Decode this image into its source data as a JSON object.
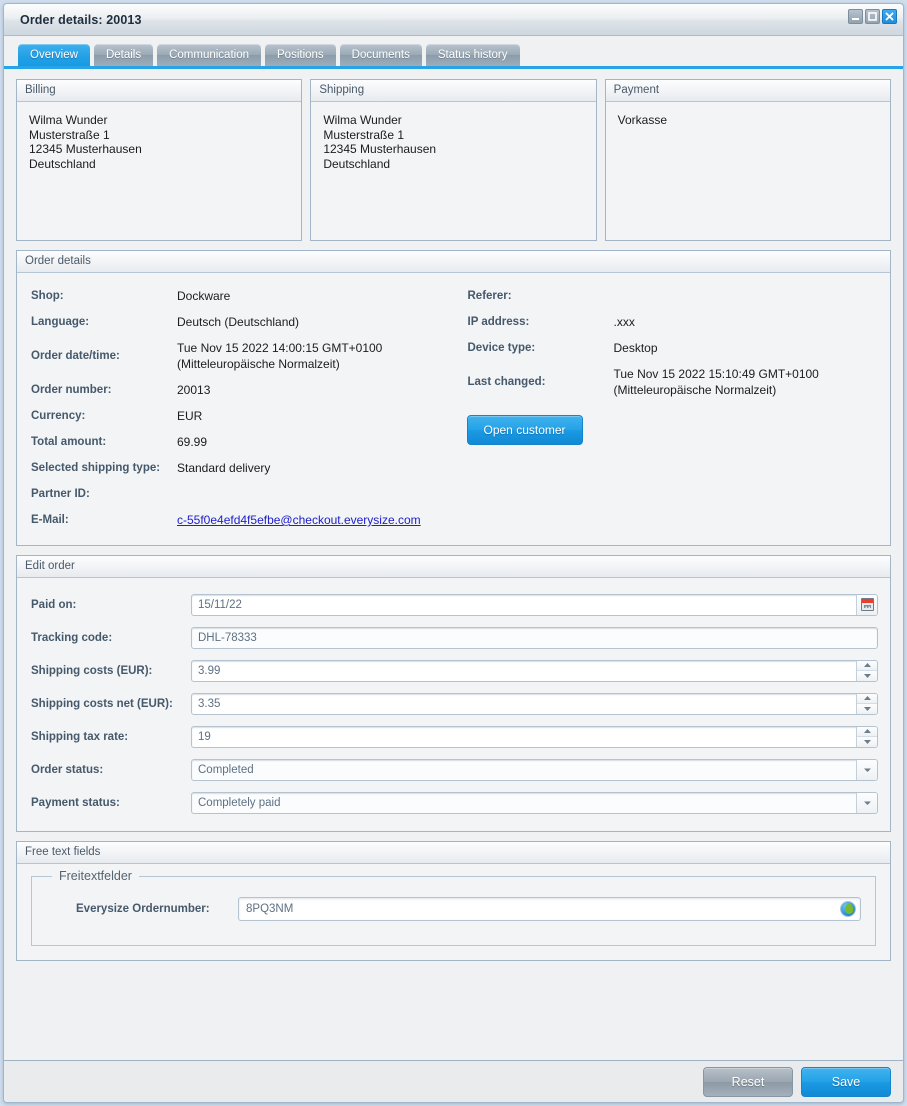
{
  "window": {
    "title": "Order details: 20013",
    "controls": [
      {
        "name": "minimize-button",
        "icon": "minimize-icon"
      },
      {
        "name": "maximize-button",
        "icon": "maximize-icon"
      },
      {
        "name": "close-button",
        "icon": "close-icon",
        "color": "#1e8fdc"
      }
    ]
  },
  "tabs": [
    {
      "label": "Overview",
      "active": true
    },
    {
      "label": "Details",
      "active": false
    },
    {
      "label": "Communication",
      "active": false
    },
    {
      "label": "Positions",
      "active": false
    },
    {
      "label": "Documents",
      "active": false
    },
    {
      "label": "Status history",
      "active": false
    }
  ],
  "address_panels": [
    {
      "title": "Billing",
      "lines": [
        "Wilma Wunder",
        "Musterstraße 1",
        "12345 Musterhausen",
        "Deutschland"
      ]
    },
    {
      "title": "Shipping",
      "lines": [
        "Wilma Wunder",
        "Musterstraße 1",
        "12345 Musterhausen",
        "Deutschland"
      ]
    },
    {
      "title": "Payment",
      "lines": [
        "Vorkasse"
      ]
    }
  ],
  "order_details": {
    "title": "Order details",
    "left": [
      {
        "label": "Shop:",
        "value": "Dockware"
      },
      {
        "label": "Language:",
        "value": "Deutsch (Deutschland)"
      },
      {
        "label": "Order date/time:",
        "value": "Tue Nov 15 2022 14:00:15 GMT+0100",
        "value2": "(Mitteleuropäische Normalzeit)"
      },
      {
        "label": "Order number:",
        "value": "20013"
      },
      {
        "label": "Currency:",
        "value": "EUR"
      },
      {
        "label": "Total amount:",
        "value": "69.99"
      },
      {
        "label": "Selected shipping type:",
        "value": "Standard delivery"
      },
      {
        "label": "Partner ID:",
        "value": ""
      },
      {
        "label": "E-Mail:",
        "value": "c-55f0e4efd4f5efbe@checkout.everysize.com",
        "is_link": true
      }
    ],
    "right": [
      {
        "label": "Referer:",
        "value": ""
      },
      {
        "label": "IP address:",
        "value": ".xxx"
      },
      {
        "label": "Device type:",
        "value": "Desktop"
      },
      {
        "label": "Last changed:",
        "value": "Tue Nov 15 2022 15:10:49 GMT+0100",
        "value2": "(Mitteleuropäische Normalzeit)"
      }
    ],
    "open_customer_button": "Open customer"
  },
  "edit_order": {
    "title": "Edit order",
    "fields": [
      {
        "label": "Paid on:",
        "value": "15/11/22",
        "control": "datepicker",
        "icon": "calendar-icon",
        "name": "paid-on"
      },
      {
        "label": "Tracking code:",
        "value": "DHL-78333",
        "control": "text",
        "name": "tracking-code"
      },
      {
        "label": "Shipping costs (EUR):",
        "value": "3.99",
        "control": "spinner",
        "name": "shipping-costs"
      },
      {
        "label": "Shipping costs net (EUR):",
        "value": "3.35",
        "control": "spinner",
        "name": "shipping-costs-net"
      },
      {
        "label": "Shipping tax rate:",
        "value": "19",
        "control": "spinner",
        "name": "shipping-tax-rate"
      },
      {
        "label": "Order status:",
        "value": "Completed",
        "control": "select",
        "name": "order-status"
      },
      {
        "label": "Payment status:",
        "value": "Completely paid",
        "control": "select",
        "name": "payment-status"
      }
    ]
  },
  "free_text_fields": {
    "title": "Free text fields",
    "legend": "Freitextfelder",
    "row_label": "Everysize Ordernumber:",
    "row_value": "8PQ3NM",
    "row_icon": "globe-icon"
  },
  "footer": {
    "reset_label": "Reset",
    "save_label": "Save"
  }
}
